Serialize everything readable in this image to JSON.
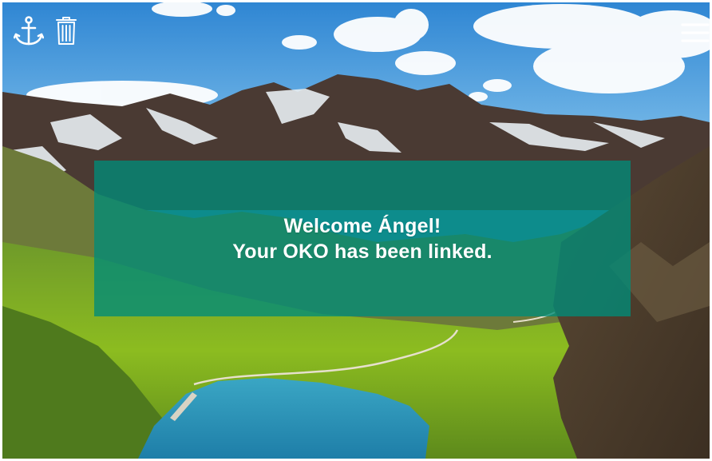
{
  "toolbar": {
    "left_icons": [
      "anchor-icon",
      "trash-icon"
    ],
    "right_icon": "menu-icon"
  },
  "welcome": {
    "line1": "Welcome Ángel!",
    "line2": "Your OKO has been linked."
  },
  "colors": {
    "overlay": "#008c78",
    "text": "#ffffff",
    "icon": "#ffffff"
  }
}
